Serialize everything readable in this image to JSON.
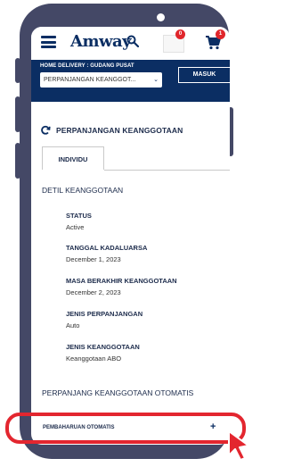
{
  "header": {
    "logo": "Amway",
    "notification_count": "0",
    "cart_count": "1"
  },
  "banner": {
    "title": "HOME DELIVERY : GUDANG PUSAT",
    "select_value": "PERPANJANGAN KEANGGOT...",
    "login_button": "MASUK"
  },
  "section": {
    "title": "PERPANJANGAN KEANGGOTAAN",
    "tab_label": "INDIVIDU",
    "detail_title": "DETIL KEANGGOTAAN"
  },
  "fields": [
    {
      "label": "STATUS",
      "value": "Active"
    },
    {
      "label": "TANGGAL KADALUARSA",
      "value": "December 1, 2023"
    },
    {
      "label": "MASA BERAKHIR KEANGGOTAAN",
      "value": "December 2, 2023"
    },
    {
      "label": "JENIS PERPANJANGAN",
      "value": "Auto"
    },
    {
      "label": "JENIS KEANGGOTAAN",
      "value": "Keanggotaan ABO"
    }
  ],
  "auto_renewal": {
    "title": "PERPANJANG KEANGGOTAAN OTOMATIS",
    "row_label": "PEMBAHARUAN OTOMATIS",
    "expand_symbol": "+"
  },
  "colors": {
    "phone_frame": "#444866",
    "brand_navy": "#0b2e63",
    "highlight_red": "#e3262f",
    "badge_red": "#e0262b"
  }
}
